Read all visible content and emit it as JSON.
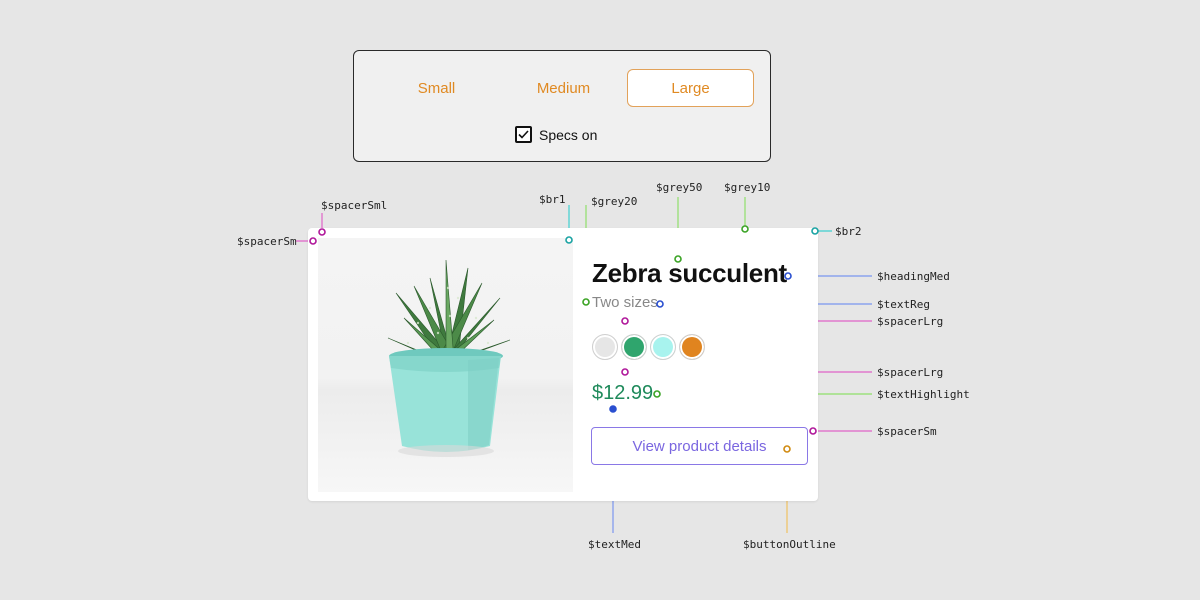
{
  "size_selector": {
    "options": [
      {
        "label": "Small",
        "selected": false
      },
      {
        "label": "Medium",
        "selected": false
      },
      {
        "label": "Large",
        "selected": true
      }
    ],
    "specs_label": "Specs on",
    "specs_checked": true
  },
  "product": {
    "title": "Zebra succulent",
    "subtitle": "Two sizes",
    "price": "$12.99",
    "cta_label": "View product details",
    "image_icon": "potted-succulent-photo",
    "swatches": [
      "#e6e6e6",
      "#2fa56d",
      "#a8f3ee",
      "#e0841f"
    ],
    "colors": {
      "accent": "#e08a23",
      "price": "#1f8a5b",
      "button": "#7a66e0"
    }
  },
  "annotations": {
    "spacer_sml": "$spacerSml",
    "spacer_sm_left": "$spacerSm",
    "br1": "$br1",
    "grey20": "$grey20",
    "grey50": "$grey50",
    "grey10": "$grey10",
    "br2": "$br2",
    "heading_med": "$headingMed",
    "text_reg": "$textReg",
    "spacer_lrg_1": "$spacerLrg",
    "spacer_lrg_2": "$spacerLrg",
    "text_highlight": "$textHighlight",
    "spacer_sm_right": "$spacerSm",
    "text_med": "$textMed",
    "button_outline": "$buttonOutline"
  }
}
